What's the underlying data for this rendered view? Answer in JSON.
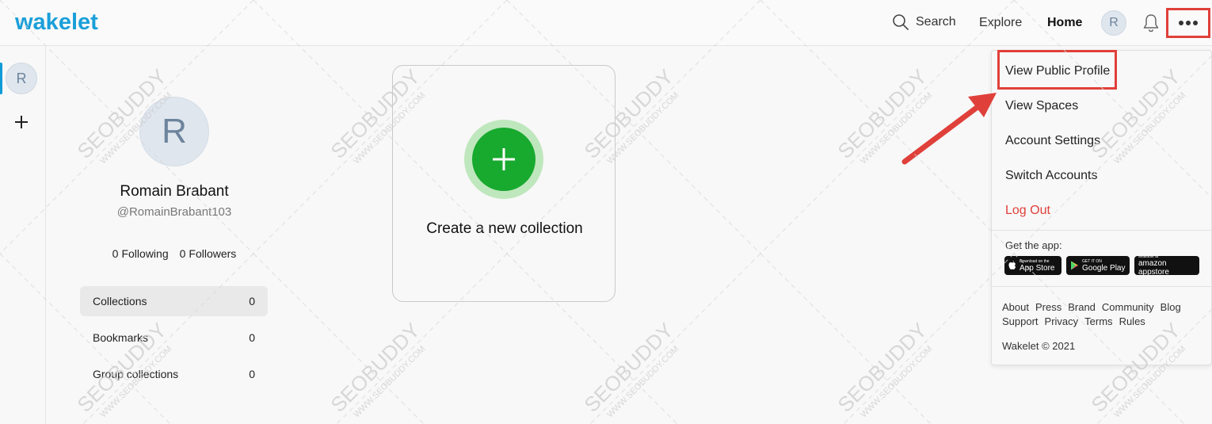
{
  "header": {
    "logo_text": "wakelet",
    "search_label": "Search",
    "explore_label": "Explore",
    "home_label": "Home",
    "avatar_letter": "R"
  },
  "rail": {
    "avatar_letter": "R"
  },
  "profile": {
    "avatar_letter": "R",
    "name": "Romain Brabant",
    "handle": "@RomainBrabant103",
    "following_count": "0",
    "following_label": "Following",
    "followers_count": "0",
    "followers_label": "Followers",
    "menu": [
      {
        "label": "Collections",
        "count": "0"
      },
      {
        "label": "Bookmarks",
        "count": "0"
      },
      {
        "label": "Group collections",
        "count": "0"
      }
    ]
  },
  "create_card": {
    "label": "Create a new collection"
  },
  "dropdown": {
    "items": [
      "View Public Profile",
      "View Spaces",
      "Account Settings",
      "Switch Accounts",
      "Log Out"
    ],
    "get_app_label": "Get the app:",
    "stores": [
      {
        "small": "Download on the",
        "big": "App Store"
      },
      {
        "small": "GET IT ON",
        "big": "Google Play"
      },
      {
        "small": "available at",
        "big": "amazon appstore"
      }
    ],
    "footer_links_row1": [
      "About",
      "Press",
      "Brand",
      "Community",
      "Blog"
    ],
    "footer_links_row2": [
      "Support",
      "Privacy",
      "Terms",
      "Rules"
    ],
    "copyright": "Wakelet © 2021"
  },
  "watermark": {
    "text": "SEOBUDDY",
    "url": "WWW.SEOBUDDY.COM"
  },
  "colors": {
    "brand_blue": "#1a9fd9",
    "create_green": "#18a92f",
    "annotation_red": "#e0403a",
    "logout_red": "#e0403a"
  }
}
